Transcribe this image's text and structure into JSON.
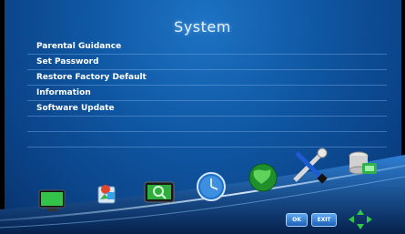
{
  "header": {
    "title": "System"
  },
  "menu": {
    "items": [
      {
        "label": "Parental Guidance"
      },
      {
        "label": "Set Password"
      },
      {
        "label": "Restore Factory Default"
      },
      {
        "label": "Information"
      },
      {
        "label": "Software Update"
      }
    ]
  },
  "toolbar": {
    "icons": [
      "tv-icon",
      "media-icon",
      "search-screen-icon",
      "clock-icon",
      "globe-icon",
      "tools-icon",
      "database-icon"
    ],
    "ok_label": "OK",
    "exit_label": "EXIT"
  },
  "colors": {
    "background": "#0f57a3",
    "text": "#ffffff",
    "accent": "#4ca0f0"
  }
}
